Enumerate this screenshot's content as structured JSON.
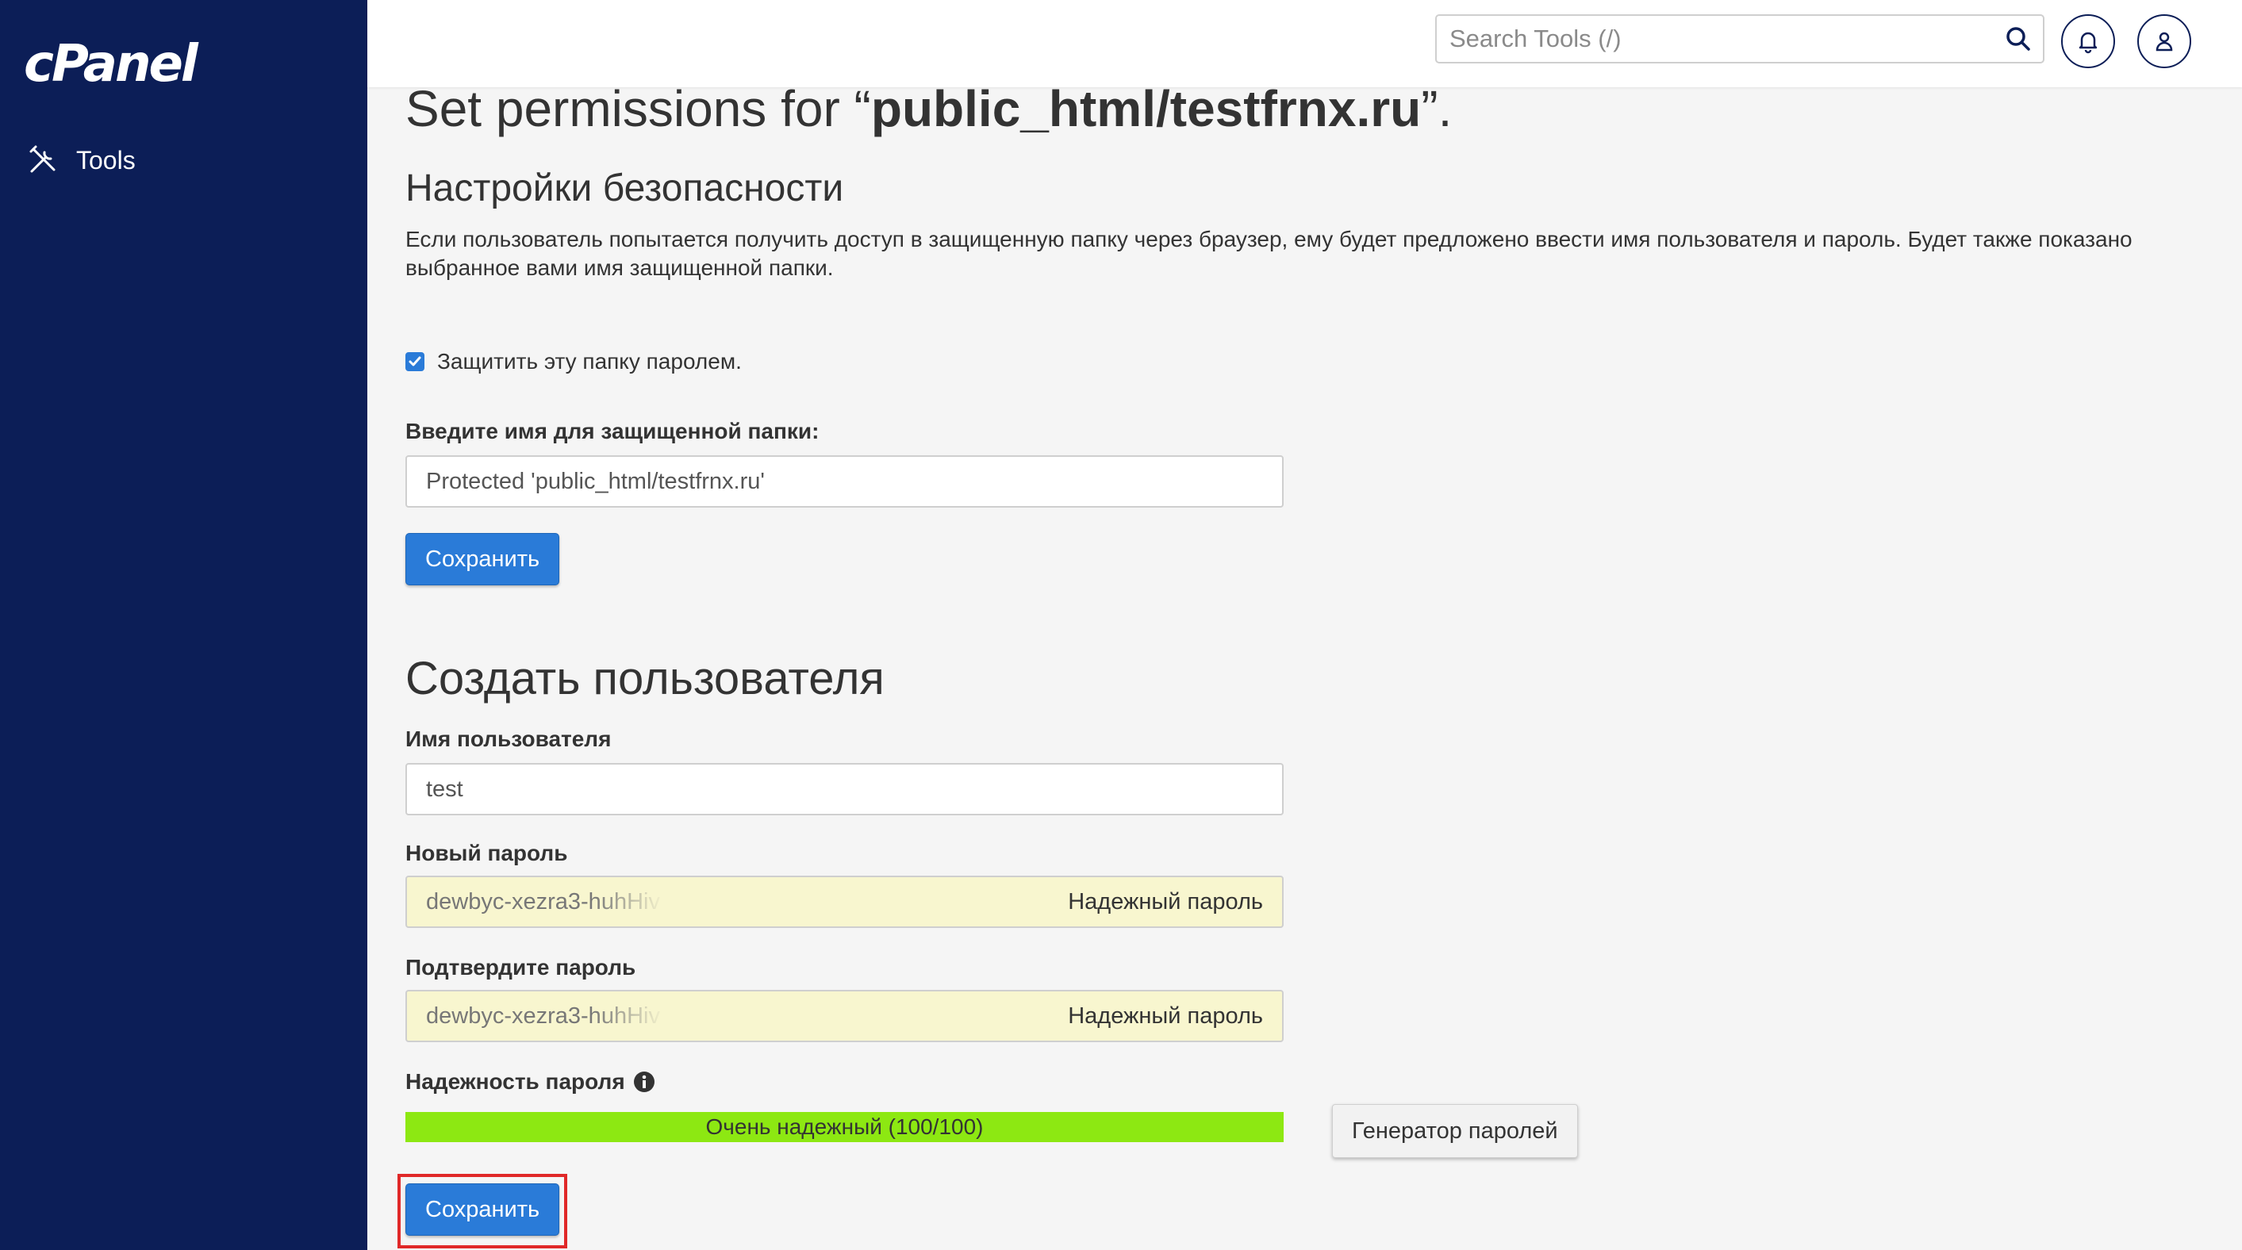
{
  "sidebar": {
    "logo": "cPanel",
    "items": [
      {
        "label": "Tools",
        "icon": "tools-icon"
      }
    ]
  },
  "header": {
    "search_placeholder": "Search Tools (/)",
    "icons": [
      "search-icon",
      "bell-icon",
      "user-icon"
    ]
  },
  "main": {
    "title_prefix": "Set permissions for “",
    "title_path": "public_html/testfrnx.ru",
    "title_suffix": "”.",
    "security": {
      "heading": "Настройки безопасности",
      "description": "Если пользователь попытается получить доступ в защищенную папку через браузер, ему будет предложено ввести имя пользователя и пароль. Будет также показано выбранное вами имя защищенной папки.",
      "checkbox_label": "Защитить эту папку паролем.",
      "checkbox_checked": true,
      "folder_name_label": "Введите имя для защищенной папки:",
      "folder_name_value": "Protected 'public_html/testfrnx.ru'",
      "save_label": "Сохранить"
    },
    "create_user": {
      "heading": "Создать пользователя",
      "username_label": "Имя пользователя",
      "username_value": "test",
      "new_password_label": "Новый пароль",
      "new_password_value": "dewbyc-xezra3-huhHiv",
      "new_password_hint": "Надежный пароль",
      "confirm_password_label": "Подтвердите пароль",
      "confirm_password_value": "dewbyc-xezra3-huhHiv",
      "confirm_password_hint": "Надежный пароль",
      "strength_label": "Надежность пароля",
      "strength_text": "Очень надежный (100/100)",
      "strength_value": 100,
      "generator_label": "Генератор паролей",
      "save_label": "Сохранить"
    }
  },
  "colors": {
    "sidebar_bg": "#0c1e57",
    "primary": "#2a7bd8",
    "meter": "#8de812",
    "password_field_bg": "#f8f6cf",
    "highlight": "#e02828"
  }
}
